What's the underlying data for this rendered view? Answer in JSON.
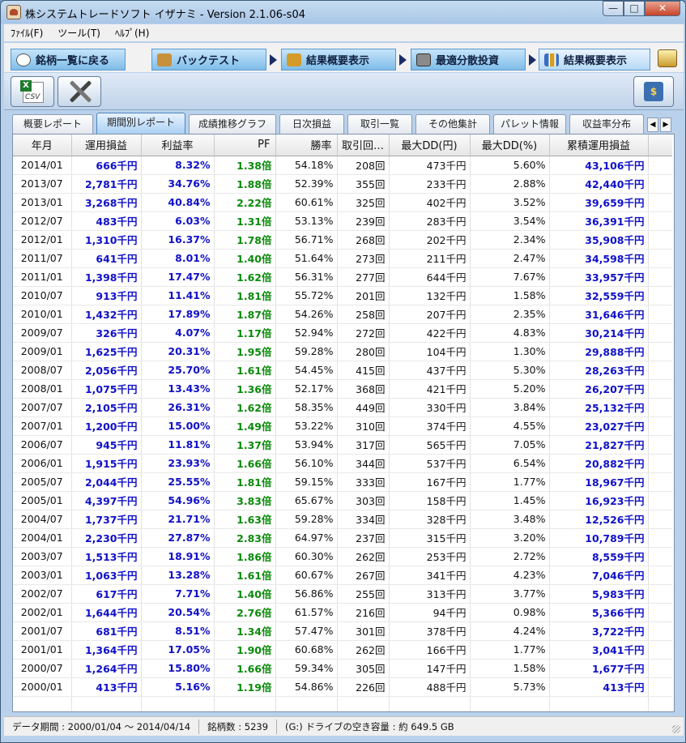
{
  "window": {
    "title": "株システムトレードソフト イザナミ - Version 2.1.06-s04",
    "buttons": {
      "minimize": "—",
      "maximize": "□",
      "close": "✕"
    }
  },
  "menu": [
    {
      "label": "ﾌｧｲﾙ(F)"
    },
    {
      "label": "ツール(T)"
    },
    {
      "label": "ﾍﾙﾌﾟ(H)"
    }
  ],
  "nav_tabs": [
    {
      "label": "銘柄一覧に戻る",
      "icon": "eye-icon"
    },
    {
      "label": "バックテスト",
      "icon": "bag-icon"
    },
    {
      "label": "結果概要表示",
      "icon": "money-hand-icon"
    },
    {
      "label": "最適分散投資",
      "icon": "calculator-icon"
    },
    {
      "label": "結果概要表示",
      "icon": "bar-chart-icon"
    }
  ],
  "toolbar": {
    "csv_label": "CSV"
  },
  "sub_tabs": [
    {
      "label": "概要レポート"
    },
    {
      "label": "期間別レポート"
    },
    {
      "label": "成績推移グラフ"
    },
    {
      "label": "日次損益"
    },
    {
      "label": "取引一覧"
    },
    {
      "label": "その他集計"
    },
    {
      "label": "パレット情報"
    },
    {
      "label": "収益率分布"
    }
  ],
  "scroll_buttons": {
    "left": "◀",
    "right": "▶"
  },
  "columns": [
    "年月",
    "運用損益",
    "利益率",
    "PF",
    "勝率",
    "取引回…",
    "最大DD(円)",
    "最大DD(%)",
    "累積運用損益"
  ],
  "rows": [
    [
      "2014/01",
      "666千円",
      "8.32%",
      "1.38倍",
      "54.18%",
      "208回",
      "473千円",
      "5.60%",
      "43,106千円"
    ],
    [
      "2013/07",
      "2,781千円",
      "34.76%",
      "1.88倍",
      "52.39%",
      "355回",
      "233千円",
      "2.88%",
      "42,440千円"
    ],
    [
      "2013/01",
      "3,268千円",
      "40.84%",
      "2.22倍",
      "60.61%",
      "325回",
      "402千円",
      "3.52%",
      "39,659千円"
    ],
    [
      "2012/07",
      "483千円",
      "6.03%",
      "1.31倍",
      "53.13%",
      "239回",
      "283千円",
      "3.54%",
      "36,391千円"
    ],
    [
      "2012/01",
      "1,310千円",
      "16.37%",
      "1.78倍",
      "56.71%",
      "268回",
      "202千円",
      "2.34%",
      "35,908千円"
    ],
    [
      "2011/07",
      "641千円",
      "8.01%",
      "1.40倍",
      "51.64%",
      "273回",
      "211千円",
      "2.47%",
      "34,598千円"
    ],
    [
      "2011/01",
      "1,398千円",
      "17.47%",
      "1.62倍",
      "56.31%",
      "277回",
      "644千円",
      "7.67%",
      "33,957千円"
    ],
    [
      "2010/07",
      "913千円",
      "11.41%",
      "1.81倍",
      "55.72%",
      "201回",
      "132千円",
      "1.58%",
      "32,559千円"
    ],
    [
      "2010/01",
      "1,432千円",
      "17.89%",
      "1.87倍",
      "54.26%",
      "258回",
      "207千円",
      "2.35%",
      "31,646千円"
    ],
    [
      "2009/07",
      "326千円",
      "4.07%",
      "1.17倍",
      "52.94%",
      "272回",
      "422千円",
      "4.83%",
      "30,214千円"
    ],
    [
      "2009/01",
      "1,625千円",
      "20.31%",
      "1.95倍",
      "59.28%",
      "280回",
      "104千円",
      "1.30%",
      "29,888千円"
    ],
    [
      "2008/07",
      "2,056千円",
      "25.70%",
      "1.61倍",
      "54.45%",
      "415回",
      "437千円",
      "5.30%",
      "28,263千円"
    ],
    [
      "2008/01",
      "1,075千円",
      "13.43%",
      "1.36倍",
      "52.17%",
      "368回",
      "421千円",
      "5.20%",
      "26,207千円"
    ],
    [
      "2007/07",
      "2,105千円",
      "26.31%",
      "1.62倍",
      "58.35%",
      "449回",
      "330千円",
      "3.84%",
      "25,132千円"
    ],
    [
      "2007/01",
      "1,200千円",
      "15.00%",
      "1.49倍",
      "53.22%",
      "310回",
      "374千円",
      "4.55%",
      "23,027千円"
    ],
    [
      "2006/07",
      "945千円",
      "11.81%",
      "1.37倍",
      "53.94%",
      "317回",
      "565千円",
      "7.05%",
      "21,827千円"
    ],
    [
      "2006/01",
      "1,915千円",
      "23.93%",
      "1.66倍",
      "56.10%",
      "344回",
      "537千円",
      "6.54%",
      "20,882千円"
    ],
    [
      "2005/07",
      "2,044千円",
      "25.55%",
      "1.81倍",
      "59.15%",
      "333回",
      "167千円",
      "1.77%",
      "18,967千円"
    ],
    [
      "2005/01",
      "4,397千円",
      "54.96%",
      "3.83倍",
      "65.67%",
      "303回",
      "158千円",
      "1.45%",
      "16,923千円"
    ],
    [
      "2004/07",
      "1,737千円",
      "21.71%",
      "1.63倍",
      "59.28%",
      "334回",
      "328千円",
      "3.48%",
      "12,526千円"
    ],
    [
      "2004/01",
      "2,230千円",
      "27.87%",
      "2.83倍",
      "64.97%",
      "237回",
      "315千円",
      "3.20%",
      "10,789千円"
    ],
    [
      "2003/07",
      "1,513千円",
      "18.91%",
      "1.86倍",
      "60.30%",
      "262回",
      "253千円",
      "2.72%",
      "8,559千円"
    ],
    [
      "2003/01",
      "1,063千円",
      "13.28%",
      "1.61倍",
      "60.67%",
      "267回",
      "341千円",
      "4.23%",
      "7,046千円"
    ],
    [
      "2002/07",
      "617千円",
      "7.71%",
      "1.40倍",
      "56.86%",
      "255回",
      "313千円",
      "3.77%",
      "5,983千円"
    ],
    [
      "2002/01",
      "1,644千円",
      "20.54%",
      "2.76倍",
      "61.57%",
      "216回",
      "94千円",
      "0.98%",
      "5,366千円"
    ],
    [
      "2001/07",
      "681千円",
      "8.51%",
      "1.34倍",
      "57.47%",
      "301回",
      "378千円",
      "4.24%",
      "3,722千円"
    ],
    [
      "2001/01",
      "1,364千円",
      "17.05%",
      "1.90倍",
      "60.68%",
      "262回",
      "166千円",
      "1.77%",
      "3,041千円"
    ],
    [
      "2000/07",
      "1,264千円",
      "15.80%",
      "1.66倍",
      "59.34%",
      "305回",
      "147千円",
      "1.58%",
      "1,677千円"
    ],
    [
      "2000/01",
      "413千円",
      "5.16%",
      "1.19倍",
      "54.86%",
      "226回",
      "488千円",
      "5.73%",
      "413千円"
    ]
  ],
  "status": {
    "period": "データ期間 : 2000/01/04 〜 2014/04/14",
    "count": "銘柄数 : 5239",
    "drive": "(G:) ドライブの空き容量 : 約 649.5 GB"
  },
  "colors": {
    "profit_text": "#1010c8",
    "pf_text": "#0a8a0a",
    "nav_tab": "#7fbde8",
    "active_subtab": "#a9cff3"
  }
}
